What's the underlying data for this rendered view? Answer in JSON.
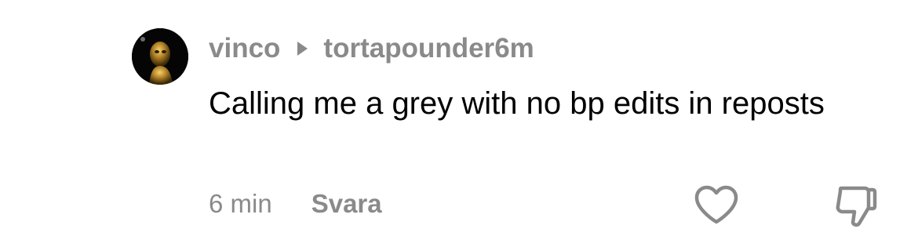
{
  "comment": {
    "author": "vinco",
    "reply_to": "tortapounder",
    "header_time": "6m",
    "text": "Calling me a grey with no bp edits in reposts",
    "time": "6 min",
    "reply_label": "Svara"
  },
  "icons": {
    "reply_to": "play-triangle-icon",
    "like": "heart-outline-icon",
    "dislike": "thumbs-down-outline-icon"
  },
  "colors": {
    "text": "#000000",
    "muted": "#8a8a8a",
    "background": "#ffffff"
  }
}
